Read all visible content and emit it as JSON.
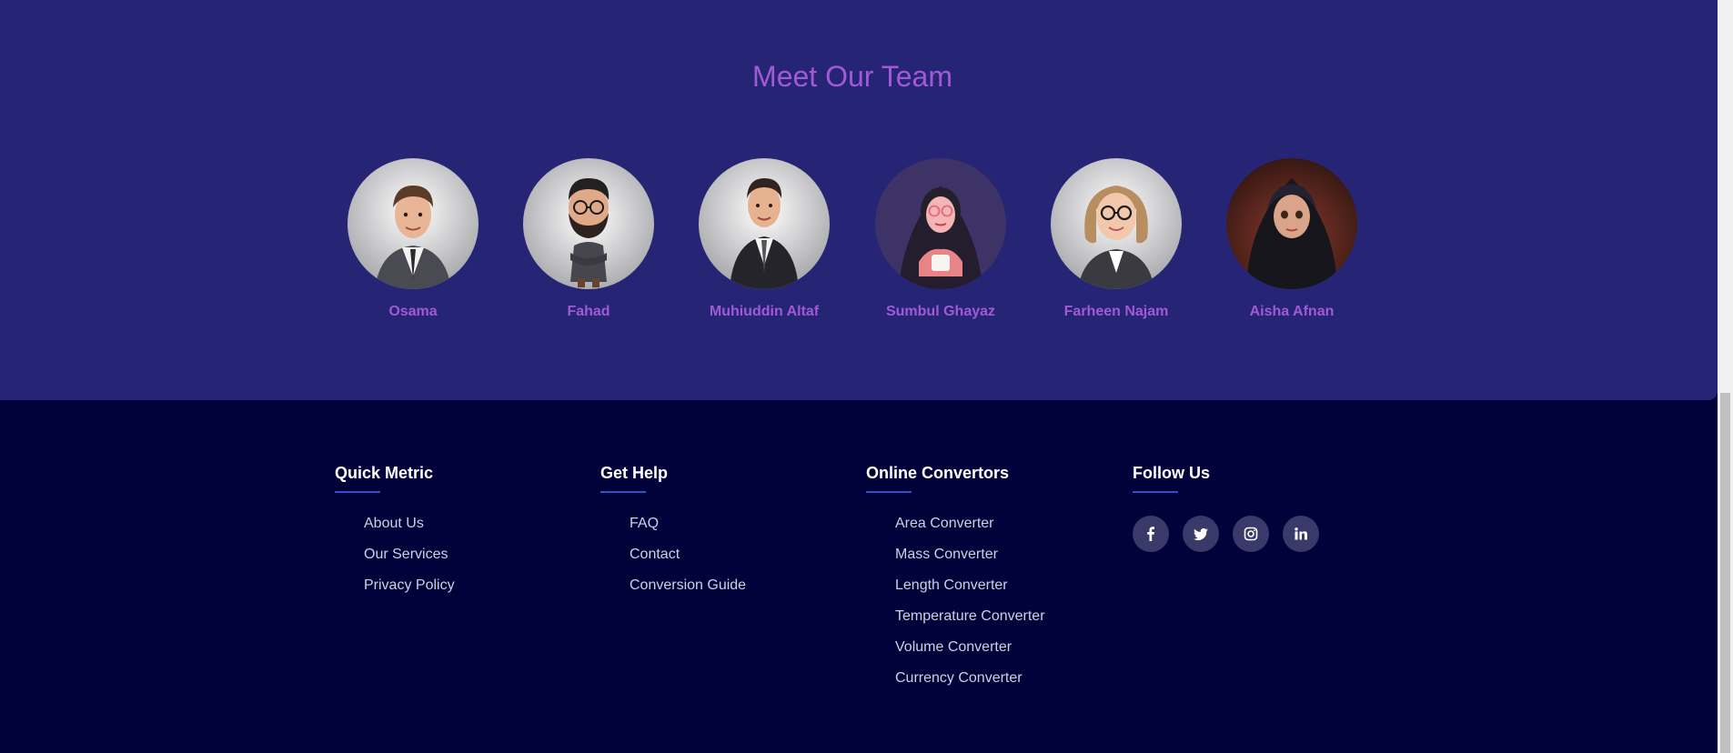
{
  "team": {
    "title": "Meet Our Team",
    "members": [
      {
        "name": "Osama",
        "avatar_icon": "man-suit-avatar-icon"
      },
      {
        "name": "Fahad",
        "avatar_icon": "bearded-man-glasses-avatar-icon"
      },
      {
        "name": "Muhiuddin Altaf",
        "avatar_icon": "man-black-suit-avatar-icon"
      },
      {
        "name": "Sumbul Ghayaz",
        "avatar_icon": "hijab-woman-mug-avatar-icon"
      },
      {
        "name": "Farheen Najam",
        "avatar_icon": "woman-glasses-avatar-icon"
      },
      {
        "name": "Aisha Afnan",
        "avatar_icon": "hijab-girl-avatar-icon"
      }
    ]
  },
  "footer": {
    "quick_metric": {
      "title": "Quick Metric",
      "links": [
        "About Us",
        "Our Services",
        "Privacy Policy"
      ]
    },
    "get_help": {
      "title": "Get Help",
      "links": [
        "FAQ",
        "Contact",
        "Conversion Guide"
      ]
    },
    "online_convertors": {
      "title": "Online Convertors",
      "links": [
        "Area Converter",
        "Mass Converter",
        "Length Converter",
        "Temperature Converter",
        "Volume Converter",
        "Currency Converter"
      ]
    },
    "follow_us": {
      "title": "Follow Us",
      "socials": [
        "facebook-icon",
        "twitter-icon",
        "instagram-icon",
        "linkedin-icon"
      ]
    }
  },
  "colors": {
    "team_bg": "#262474",
    "footer_bg": "#02023a",
    "accent_purple": "#a15ad6",
    "underline_blue": "#2a56c9",
    "social_bg": "#3a3a6a"
  }
}
